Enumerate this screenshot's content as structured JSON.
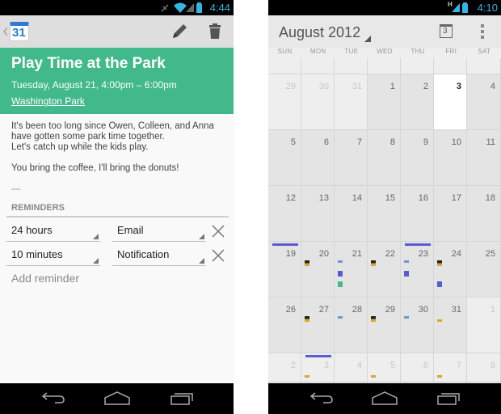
{
  "left_screen": {
    "status_bar": {
      "time": "4:44",
      "icons": [
        "mute-icon",
        "wifi-icon",
        "signal-icon",
        "battery-icon"
      ]
    },
    "action_bar": {
      "back_icon": "back-chevron-icon",
      "app_icon_day": "31",
      "edit_icon": "pencil-icon",
      "delete_icon": "trash-icon"
    },
    "event": {
      "title": "Play Time at the Park",
      "when": "Tuesday, August 21, 4:00pm – 6:00pm",
      "where": "Washington Park",
      "description": [
        "It's been too long since Owen, Colleen, and Anna\nhave gotten some park time together.\nLet's catch up while the kids play.",
        "You bring the coffee, I'll bring the donuts!",
        "---"
      ],
      "color": "#41b98a"
    },
    "reminders": {
      "label": "REMINDERS",
      "items": [
        {
          "time": "24 hours",
          "method": "Email"
        },
        {
          "time": "10 minutes",
          "method": "Notification"
        }
      ],
      "add_label": "Add reminder"
    }
  },
  "right_screen": {
    "status_bar": {
      "time": "4:10",
      "network": "H"
    },
    "action_bar": {
      "title": "August 2012",
      "today_icon_day": "3"
    },
    "weekdays": [
      "SUN",
      "MON",
      "TUE",
      "WED",
      "THU",
      "FRI",
      "SAT"
    ],
    "today": 3,
    "weeks": [
      [
        {
          "d": "29",
          "m": "other"
        },
        {
          "d": "30",
          "m": "other"
        },
        {
          "d": "31",
          "m": "other"
        },
        {
          "d": "1",
          "m": "cur"
        },
        {
          "d": "2",
          "m": "cur"
        },
        {
          "d": "3",
          "m": "today"
        },
        {
          "d": "4",
          "m": "cur"
        }
      ],
      [
        {
          "d": "5",
          "m": "cur"
        },
        {
          "d": "6",
          "m": "cur"
        },
        {
          "d": "7",
          "m": "cur"
        },
        {
          "d": "8",
          "m": "cur"
        },
        {
          "d": "9",
          "m": "cur"
        },
        {
          "d": "10",
          "m": "cur"
        },
        {
          "d": "11",
          "m": "cur"
        }
      ],
      [
        {
          "d": "12",
          "m": "cur"
        },
        {
          "d": "13",
          "m": "cur"
        },
        {
          "d": "14",
          "m": "cur"
        },
        {
          "d": "15",
          "m": "cur"
        },
        {
          "d": "16",
          "m": "cur"
        },
        {
          "d": "17",
          "m": "cur"
        },
        {
          "d": "18",
          "m": "cur"
        }
      ],
      [
        {
          "d": "19",
          "m": "cur"
        },
        {
          "d": "20",
          "m": "cur"
        },
        {
          "d": "21",
          "m": "cur"
        },
        {
          "d": "22",
          "m": "cur"
        },
        {
          "d": "23",
          "m": "cur"
        },
        {
          "d": "24",
          "m": "cur"
        },
        {
          "d": "25",
          "m": "cur"
        }
      ],
      [
        {
          "d": "26",
          "m": "cur"
        },
        {
          "d": "27",
          "m": "cur"
        },
        {
          "d": "28",
          "m": "cur"
        },
        {
          "d": "29",
          "m": "cur"
        },
        {
          "d": "30",
          "m": "cur"
        },
        {
          "d": "31",
          "m": "cur"
        },
        {
          "d": "1",
          "m": "other"
        }
      ],
      [
        {
          "d": "2",
          "m": "other"
        },
        {
          "d": "3",
          "m": "other"
        },
        {
          "d": "4",
          "m": "other"
        },
        {
          "d": "5",
          "m": "other"
        },
        {
          "d": "6",
          "m": "other"
        },
        {
          "d": "7",
          "m": "other"
        },
        {
          "d": "8",
          "m": "other"
        }
      ]
    ],
    "all_day_bars": [
      {
        "week": 3,
        "day": 0,
        "color": "#5a5ad2"
      },
      {
        "week": 3,
        "day": 4,
        "color": "#5a5ad2"
      },
      {
        "week": 5,
        "day": 1,
        "color": "#5a5ad2"
      }
    ],
    "event_marks": [
      {
        "week": 3,
        "day": 1,
        "slot": 0,
        "type": "black-gold"
      },
      {
        "week": 3,
        "day": 2,
        "slot": 0,
        "type": "steel"
      },
      {
        "week": 3,
        "day": 2,
        "slot": 1,
        "type": "purple"
      },
      {
        "week": 3,
        "day": 2,
        "slot": 2,
        "type": "green"
      },
      {
        "week": 3,
        "day": 3,
        "slot": 0,
        "type": "black-gold"
      },
      {
        "week": 3,
        "day": 4,
        "slot": 0,
        "type": "steel"
      },
      {
        "week": 3,
        "day": 4,
        "slot": 1,
        "type": "purple"
      },
      {
        "week": 3,
        "day": 5,
        "slot": 0,
        "type": "black-gold"
      },
      {
        "week": 3,
        "day": 5,
        "slot": 2,
        "type": "purple"
      },
      {
        "week": 4,
        "day": 1,
        "slot": 0,
        "type": "black-gold"
      },
      {
        "week": 4,
        "day": 2,
        "slot": 0,
        "type": "steel"
      },
      {
        "week": 4,
        "day": 3,
        "slot": 0,
        "type": "black-gold"
      },
      {
        "week": 4,
        "day": 4,
        "slot": 0,
        "type": "steel"
      },
      {
        "week": 4,
        "day": 5,
        "slot": 0,
        "type": "gold"
      },
      {
        "week": 5,
        "day": 1,
        "slot": 0,
        "type": "gold"
      },
      {
        "week": 5,
        "day": 3,
        "slot": 0,
        "type": "gold"
      },
      {
        "week": 5,
        "day": 5,
        "slot": 0,
        "type": "gold"
      }
    ],
    "mark_colors": {
      "steel": "#6f9ac8",
      "purple": "#5a5ad2",
      "green": "#41b98a",
      "gold": "#d9aa2a",
      "black": "#222222"
    }
  }
}
